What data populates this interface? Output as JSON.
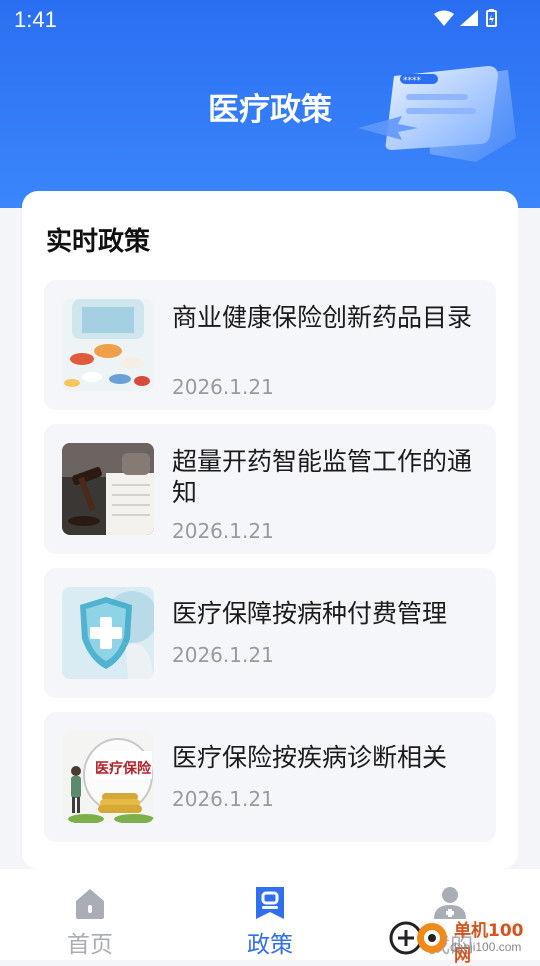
{
  "status_bar": {
    "time": "1:41"
  },
  "header": {
    "title": "医疗政策"
  },
  "section": {
    "title": "实时政策"
  },
  "policies": [
    {
      "title": "商业健康保险创新药品目录",
      "date": "2026.1.21",
      "image": "pills-image"
    },
    {
      "title": "超量开药智能监管工作的通知",
      "date": "2026.1.21",
      "image": "gavel-image"
    },
    {
      "title": "医疗保障按病种付费管理",
      "date": "2026.1.21",
      "image": "medical-shield-image"
    },
    {
      "title": "医疗保险按疾病诊断相关",
      "date": "2026.1.21",
      "image": "insurance-coins-image",
      "image_text": "医疗保险"
    }
  ],
  "tabs": [
    {
      "label": "首页",
      "icon": "home-icon",
      "active": false
    },
    {
      "label": "政策",
      "icon": "policy-icon",
      "active": true
    },
    {
      "label": "我的",
      "icon": "profile-icon",
      "active": false
    }
  ],
  "watermark": {
    "text": "单机100网",
    "url": "danji100.com"
  },
  "colors": {
    "primary": "#2a6ff2",
    "active_tab": "#2f6ff0",
    "inactive_tab": "#a9adb6",
    "date": "#9a9a9a"
  }
}
